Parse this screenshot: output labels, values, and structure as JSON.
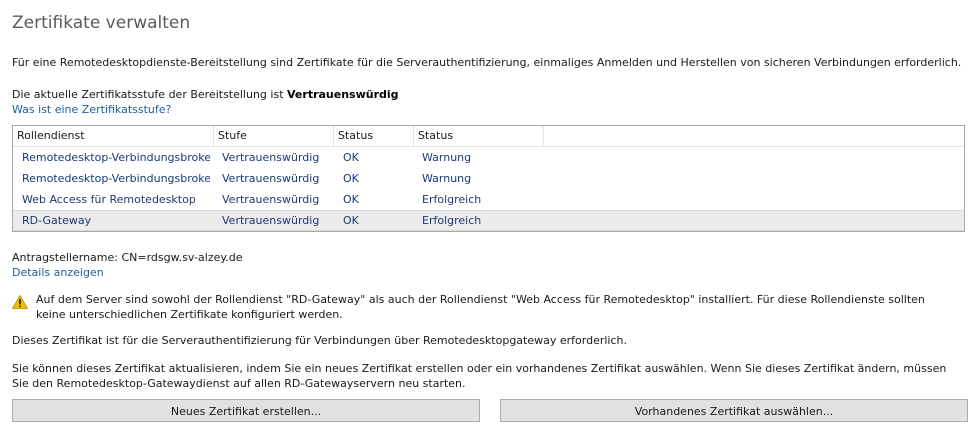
{
  "page": {
    "title": "Zertifikate verwalten",
    "intro": "Für eine Remotedesktopdienste-Bereitstellung sind Zertifikate für die Serverauthentifizierung, einmaliges Anmelden und Herstellen von sicheren Verbindungen erforderlich.",
    "level_prefix": "Die aktuelle Zertifikatsstufe der Bereitstellung ist ",
    "level_value": "Vertrauenswürdig",
    "level_link": "Was ist eine Zertifikatsstufe?"
  },
  "table": {
    "headers": [
      "Rollendienst",
      "Stufe",
      "Status",
      "Status"
    ],
    "rows": [
      {
        "role": "Remotedesktop-Verbindungsbroker",
        "level": "Vertrauenswürdig",
        "status": "OK",
        "status2": "Warnung"
      },
      {
        "role": "Remotedesktop-Verbindungsbroker",
        "level": "Vertrauenswürdig",
        "status": "OK",
        "status2": "Warnung"
      },
      {
        "role": "Web Access für Remotedesktop",
        "level": "Vertrauenswürdig",
        "status": "OK",
        "status2": "Erfolgreich"
      },
      {
        "role": "RD-Gateway",
        "level": "Vertrauenswürdig",
        "status": "OK",
        "status2": "Erfolgreich"
      }
    ]
  },
  "details": {
    "applicant": "Antragstellername: CN=rdsgw.sv-alzey.de",
    "show_details": "Details anzeigen",
    "warning": "Auf dem Server sind sowohl der Rollendienst \"RD-Gateway\" als auch der Rollendienst \"Web Access für Remotedesktop\" installiert. Für diese Rollendienste sollten keine unterschiedlichen Zertifikate konfiguriert werden.",
    "info1": "Dieses Zertifikat ist für die Serverauthentifizierung für Verbindungen über Remotedesktopgateway erforderlich.",
    "info2": "Sie können dieses Zertifikat aktualisieren, indem Sie ein neues Zertifikat erstellen oder ein vorhandenes Zertifikat auswählen. Wenn Sie dieses Zertifikat ändern, müssen Sie den Remotedesktop-Gatewaydienst auf allen RD-Gatewayservern neu starten."
  },
  "buttons": {
    "new_cert": "Neues Zertifikat erstellen...",
    "existing_cert": "Vorhandenes Zertifikat auswählen..."
  },
  "colors": {
    "link": "#1f5c99",
    "row_text": "#1b3a75",
    "selected_row": "#ebebeb",
    "warning_icon": "#f2c200"
  },
  "icons": {
    "warning": "warning-icon"
  }
}
